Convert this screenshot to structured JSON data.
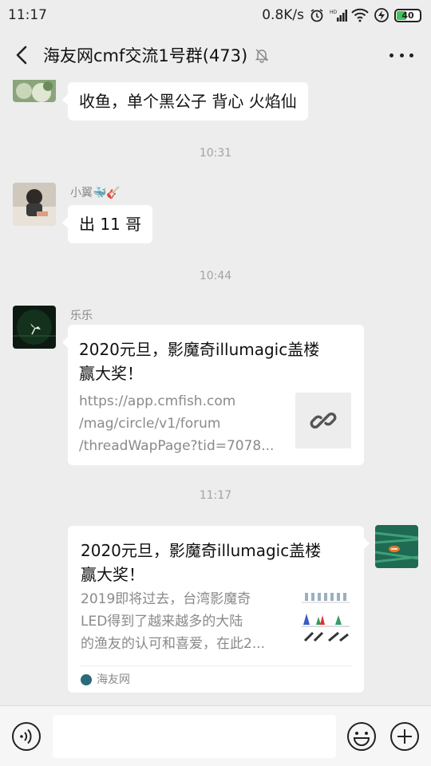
{
  "status_bar": {
    "time": "11:17",
    "speed": "0.8K/s",
    "battery_level": "40",
    "battery_fraction": 0.4
  },
  "header": {
    "back_icon": "chevron-left-icon",
    "title": "海友网cmf交流1号群(473)",
    "mute_icon": "bell-off-icon",
    "more_icon": "more-dots-icon"
  },
  "messages": [
    {
      "type": "text",
      "side": "left",
      "sender": "",
      "text": "收鱼，单个黑公子 背心 火焰仙"
    },
    {
      "type": "time",
      "text": "10:31"
    },
    {
      "type": "text",
      "side": "left",
      "sender": "小翼🐳🎸",
      "text": "出 11 哥"
    },
    {
      "type": "time",
      "text": "10:44"
    },
    {
      "type": "link",
      "side": "left",
      "sender": "乐乐",
      "title_lines": [
        "2020元旦，影魔奇illumagic盖楼",
        "赢大奖！"
      ],
      "desc_lines": [
        "https://app.cmfish.com",
        "/mag/circle/v1/forum",
        "/threadWapPage?tid=7078..."
      ],
      "thumb_icon": "link-icon"
    },
    {
      "type": "time",
      "text": "11:17"
    },
    {
      "type": "link",
      "side": "right",
      "title_lines": [
        "2020元旦，影魔奇illumagic盖楼",
        "赢大奖！"
      ],
      "desc_lines": [
        "2019即将过去，台湾影魔奇",
        "LED得到了越来越多的大陆",
        "的渔友的认可和喜爱，在此2..."
      ],
      "source": "海友网"
    }
  ],
  "input_bar": {
    "voice_icon": "voice-icon",
    "emoji_icon": "emoji-icon",
    "plus_icon": "plus-icon"
  },
  "colors": {
    "background": "#ededed",
    "bubble": "#ffffff",
    "battery_fill": "#43c35e"
  }
}
